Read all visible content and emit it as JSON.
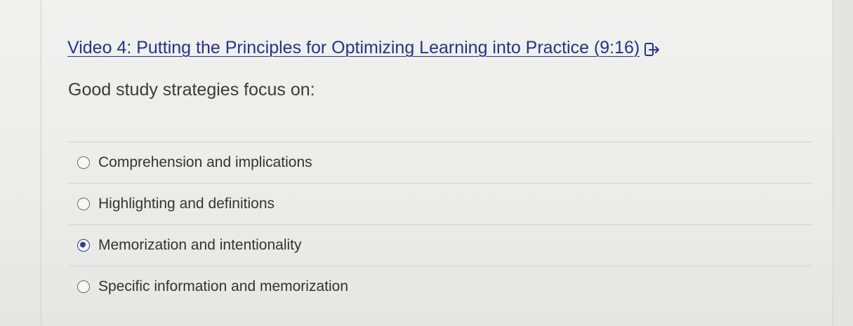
{
  "lesson": {
    "video_link_text": "Video 4: Putting the Principles for Optimizing Learning into Practice (9:16)",
    "external_link_icon": "external-link-icon",
    "question_text": "Good study strategies focus on:"
  },
  "answers": [
    {
      "label": "Comprehension and implications",
      "selected": false
    },
    {
      "label": "Highlighting and definitions",
      "selected": false
    },
    {
      "label": "Memorization and intentionality",
      "selected": true
    },
    {
      "label": "Specific information and memorization",
      "selected": false
    }
  ],
  "colors": {
    "link": "#24348f",
    "selected_radio": "#2c3f98",
    "text": "#333333"
  }
}
